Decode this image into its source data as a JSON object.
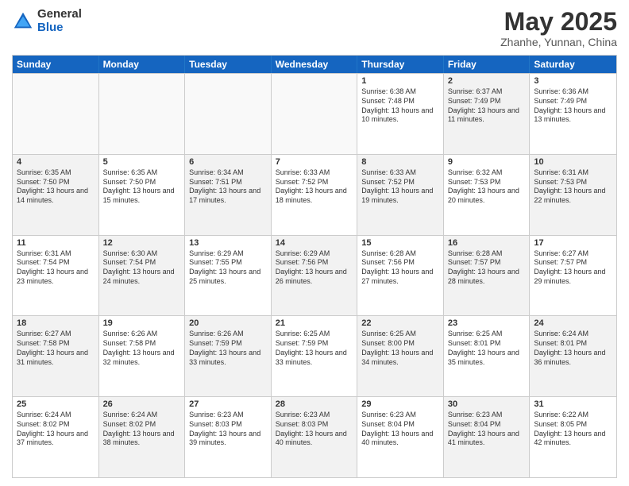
{
  "header": {
    "logo_general": "General",
    "logo_blue": "Blue",
    "month_title": "May 2025",
    "location": "Zhanhe, Yunnan, China"
  },
  "weekdays": [
    "Sunday",
    "Monday",
    "Tuesday",
    "Wednesday",
    "Thursday",
    "Friday",
    "Saturday"
  ],
  "rows": [
    {
      "cells": [
        {
          "empty": true
        },
        {
          "empty": true
        },
        {
          "empty": true
        },
        {
          "empty": true
        },
        {
          "day": "1",
          "sunrise": "Sunrise: 6:38 AM",
          "sunset": "Sunset: 7:48 PM",
          "daylight": "Daylight: 13 hours and 10 minutes.",
          "shaded": false
        },
        {
          "day": "2",
          "sunrise": "Sunrise: 6:37 AM",
          "sunset": "Sunset: 7:49 PM",
          "daylight": "Daylight: 13 hours and 11 minutes.",
          "shaded": true
        },
        {
          "day": "3",
          "sunrise": "Sunrise: 6:36 AM",
          "sunset": "Sunset: 7:49 PM",
          "daylight": "Daylight: 13 hours and 13 minutes.",
          "shaded": false
        }
      ]
    },
    {
      "cells": [
        {
          "day": "4",
          "sunrise": "Sunrise: 6:35 AM",
          "sunset": "Sunset: 7:50 PM",
          "daylight": "Daylight: 13 hours and 14 minutes.",
          "shaded": true
        },
        {
          "day": "5",
          "sunrise": "Sunrise: 6:35 AM",
          "sunset": "Sunset: 7:50 PM",
          "daylight": "Daylight: 13 hours and 15 minutes.",
          "shaded": false
        },
        {
          "day": "6",
          "sunrise": "Sunrise: 6:34 AM",
          "sunset": "Sunset: 7:51 PM",
          "daylight": "Daylight: 13 hours and 17 minutes.",
          "shaded": true
        },
        {
          "day": "7",
          "sunrise": "Sunrise: 6:33 AM",
          "sunset": "Sunset: 7:52 PM",
          "daylight": "Daylight: 13 hours and 18 minutes.",
          "shaded": false
        },
        {
          "day": "8",
          "sunrise": "Sunrise: 6:33 AM",
          "sunset": "Sunset: 7:52 PM",
          "daylight": "Daylight: 13 hours and 19 minutes.",
          "shaded": true
        },
        {
          "day": "9",
          "sunrise": "Sunrise: 6:32 AM",
          "sunset": "Sunset: 7:53 PM",
          "daylight": "Daylight: 13 hours and 20 minutes.",
          "shaded": false
        },
        {
          "day": "10",
          "sunrise": "Sunrise: 6:31 AM",
          "sunset": "Sunset: 7:53 PM",
          "daylight": "Daylight: 13 hours and 22 minutes.",
          "shaded": true
        }
      ]
    },
    {
      "cells": [
        {
          "day": "11",
          "sunrise": "Sunrise: 6:31 AM",
          "sunset": "Sunset: 7:54 PM",
          "daylight": "Daylight: 13 hours and 23 minutes.",
          "shaded": false
        },
        {
          "day": "12",
          "sunrise": "Sunrise: 6:30 AM",
          "sunset": "Sunset: 7:54 PM",
          "daylight": "Daylight: 13 hours and 24 minutes.",
          "shaded": true
        },
        {
          "day": "13",
          "sunrise": "Sunrise: 6:29 AM",
          "sunset": "Sunset: 7:55 PM",
          "daylight": "Daylight: 13 hours and 25 minutes.",
          "shaded": false
        },
        {
          "day": "14",
          "sunrise": "Sunrise: 6:29 AM",
          "sunset": "Sunset: 7:56 PM",
          "daylight": "Daylight: 13 hours and 26 minutes.",
          "shaded": true
        },
        {
          "day": "15",
          "sunrise": "Sunrise: 6:28 AM",
          "sunset": "Sunset: 7:56 PM",
          "daylight": "Daylight: 13 hours and 27 minutes.",
          "shaded": false
        },
        {
          "day": "16",
          "sunrise": "Sunrise: 6:28 AM",
          "sunset": "Sunset: 7:57 PM",
          "daylight": "Daylight: 13 hours and 28 minutes.",
          "shaded": true
        },
        {
          "day": "17",
          "sunrise": "Sunrise: 6:27 AM",
          "sunset": "Sunset: 7:57 PM",
          "daylight": "Daylight: 13 hours and 29 minutes.",
          "shaded": false
        }
      ]
    },
    {
      "cells": [
        {
          "day": "18",
          "sunrise": "Sunrise: 6:27 AM",
          "sunset": "Sunset: 7:58 PM",
          "daylight": "Daylight: 13 hours and 31 minutes.",
          "shaded": true
        },
        {
          "day": "19",
          "sunrise": "Sunrise: 6:26 AM",
          "sunset": "Sunset: 7:58 PM",
          "daylight": "Daylight: 13 hours and 32 minutes.",
          "shaded": false
        },
        {
          "day": "20",
          "sunrise": "Sunrise: 6:26 AM",
          "sunset": "Sunset: 7:59 PM",
          "daylight": "Daylight: 13 hours and 33 minutes.",
          "shaded": true
        },
        {
          "day": "21",
          "sunrise": "Sunrise: 6:25 AM",
          "sunset": "Sunset: 7:59 PM",
          "daylight": "Daylight: 13 hours and 33 minutes.",
          "shaded": false
        },
        {
          "day": "22",
          "sunrise": "Sunrise: 6:25 AM",
          "sunset": "Sunset: 8:00 PM",
          "daylight": "Daylight: 13 hours and 34 minutes.",
          "shaded": true
        },
        {
          "day": "23",
          "sunrise": "Sunrise: 6:25 AM",
          "sunset": "Sunset: 8:01 PM",
          "daylight": "Daylight: 13 hours and 35 minutes.",
          "shaded": false
        },
        {
          "day": "24",
          "sunrise": "Sunrise: 6:24 AM",
          "sunset": "Sunset: 8:01 PM",
          "daylight": "Daylight: 13 hours and 36 minutes.",
          "shaded": true
        }
      ]
    },
    {
      "cells": [
        {
          "day": "25",
          "sunrise": "Sunrise: 6:24 AM",
          "sunset": "Sunset: 8:02 PM",
          "daylight": "Daylight: 13 hours and 37 minutes.",
          "shaded": false
        },
        {
          "day": "26",
          "sunrise": "Sunrise: 6:24 AM",
          "sunset": "Sunset: 8:02 PM",
          "daylight": "Daylight: 13 hours and 38 minutes.",
          "shaded": true
        },
        {
          "day": "27",
          "sunrise": "Sunrise: 6:23 AM",
          "sunset": "Sunset: 8:03 PM",
          "daylight": "Daylight: 13 hours and 39 minutes.",
          "shaded": false
        },
        {
          "day": "28",
          "sunrise": "Sunrise: 6:23 AM",
          "sunset": "Sunset: 8:03 PM",
          "daylight": "Daylight: 13 hours and 40 minutes.",
          "shaded": true
        },
        {
          "day": "29",
          "sunrise": "Sunrise: 6:23 AM",
          "sunset": "Sunset: 8:04 PM",
          "daylight": "Daylight: 13 hours and 40 minutes.",
          "shaded": false
        },
        {
          "day": "30",
          "sunrise": "Sunrise: 6:23 AM",
          "sunset": "Sunset: 8:04 PM",
          "daylight": "Daylight: 13 hours and 41 minutes.",
          "shaded": true
        },
        {
          "day": "31",
          "sunrise": "Sunrise: 6:22 AM",
          "sunset": "Sunset: 8:05 PM",
          "daylight": "Daylight: 13 hours and 42 minutes.",
          "shaded": false
        }
      ]
    }
  ]
}
